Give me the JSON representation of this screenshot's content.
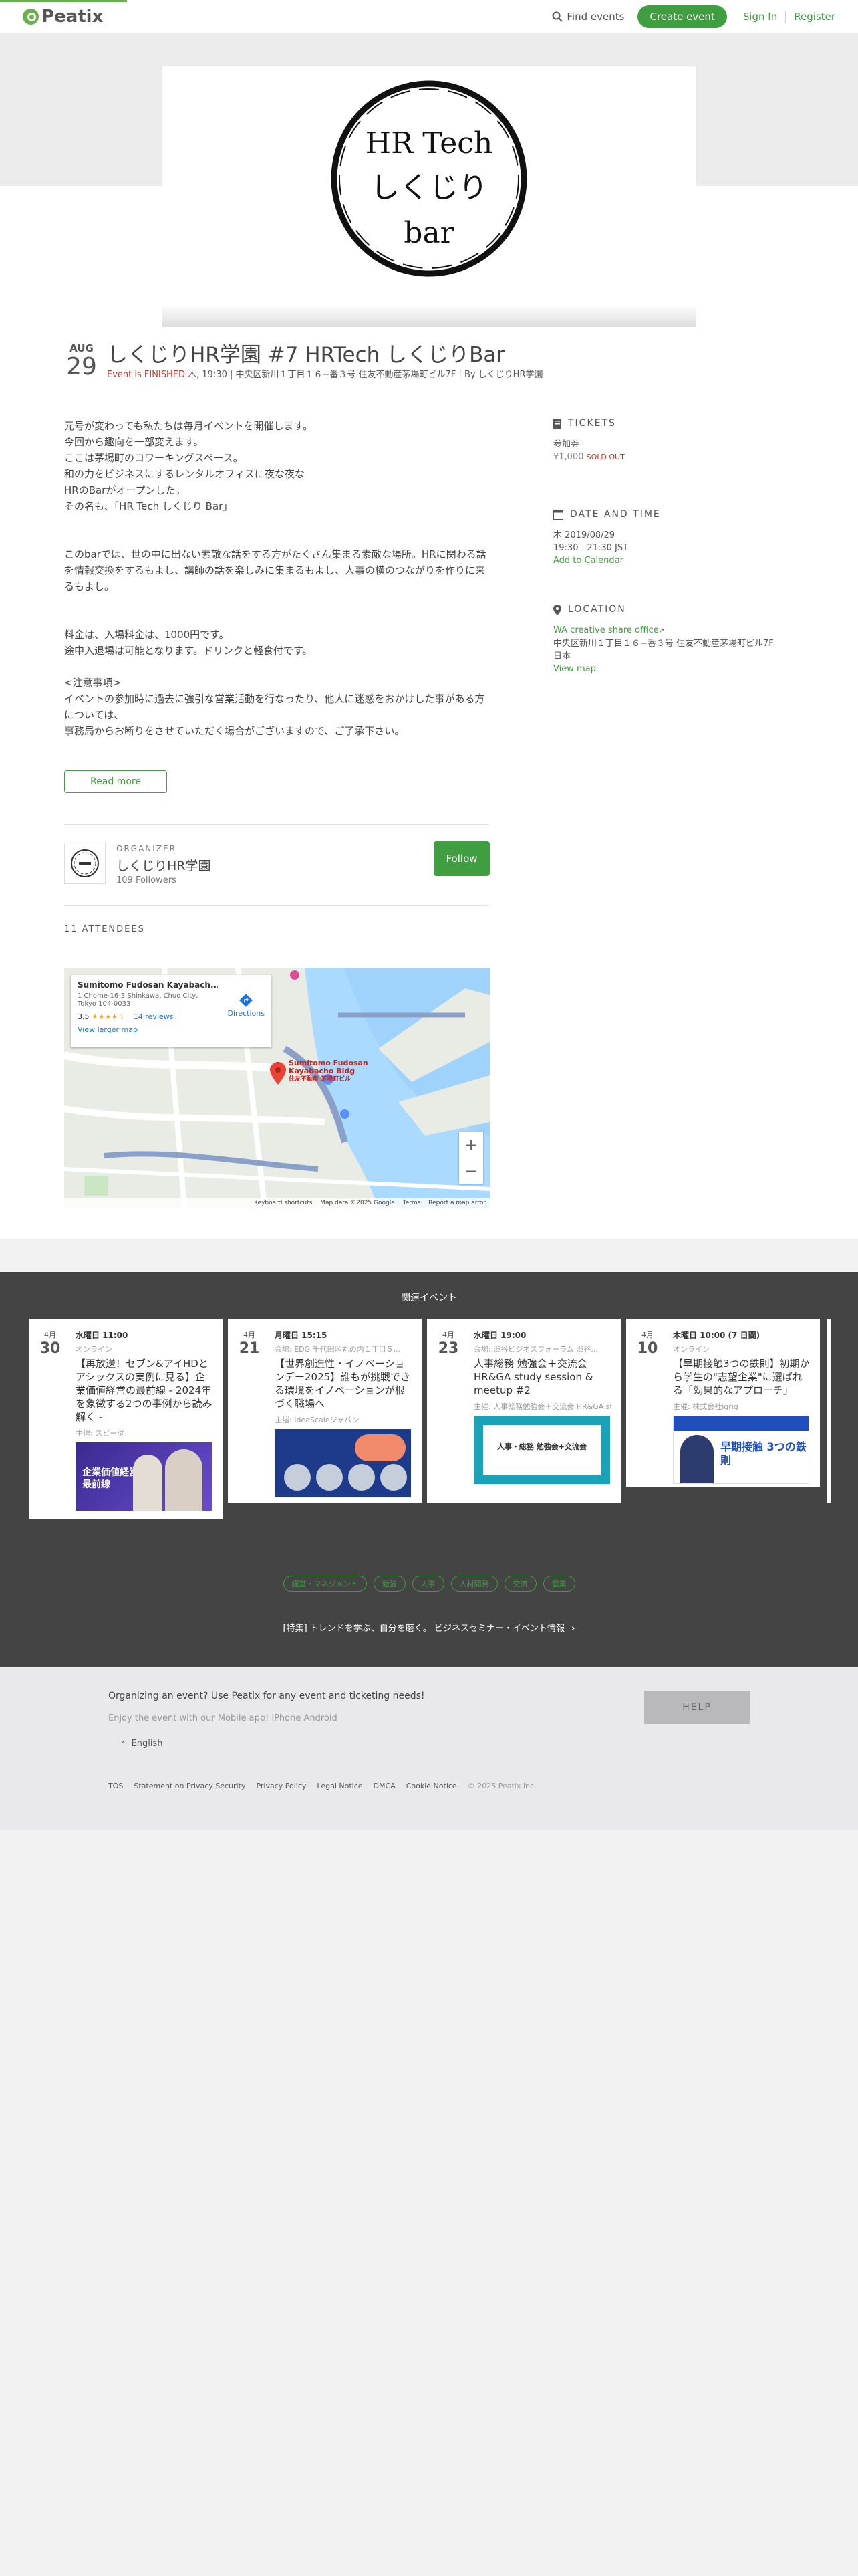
{
  "header": {
    "logo_text": "Peatix",
    "find_events": "Find events",
    "create_event": "Create event",
    "sign_in": "Sign In",
    "register": "Register"
  },
  "hero": {
    "logo_lines": [
      "HR Tech",
      "しくじり",
      "bar"
    ]
  },
  "event": {
    "month": "AUG",
    "day": "29",
    "title": "しくじりHR学園 #7 HRTech しくじりBar",
    "finished": "Event is FINISHED",
    "meta": " 木, 19:30 | 中央区新川１丁目１６−番３号 住友不動産茅場町ビル7F | By しくじりHR学園"
  },
  "description": {
    "para1": [
      "元号が変わっても私たちは毎月イベントを開催します。",
      "今回から趣向を一部変えます。",
      "ここは茅場町のコワーキングスペース。",
      "和の力をビジネスにするレンタルオフィスに夜な夜な",
      "HRのBarがオープンした。",
      "その名も、「HR Tech しくじり Bar」"
    ],
    "para2": [
      "このbarでは、世の中に出ない素敵な話をする方がたくさん集まる素敵な場所。HRに関わる話を情報交換をするもよし、講師の話を楽しみに集まるもよし、人事の横のつながりを作りに来るもよし。"
    ],
    "para3": [
      "料金は、入場料金は、1000円です。",
      "途中入退場は可能となります。ドリンクと軽食付です。"
    ],
    "para4": [
      "<注意事項>",
      "イベントの参加時に過去に強引な営業活動を行なったり、他人に迷惑をおかけした事がある方については、",
      "事務局からお断りをさせていただく場合がございますので、ご了承下さい。"
    ],
    "read_more": "Read more"
  },
  "tickets": {
    "heading": "TICKETS",
    "name": "参加券",
    "price": "¥1,000",
    "status": "SOLD OUT"
  },
  "datetime": {
    "heading": "DATE AND TIME",
    "date": "木 2019/08/29",
    "time": "19:30 - 21:30 JST",
    "add_calendar": "Add to Calendar"
  },
  "location": {
    "heading": "LOCATION",
    "venue": "WA creative share office",
    "address": "中央区新川１丁目１６−番３号 住友不動産茅場町ビル7F",
    "country": "日本",
    "view_map": "View map"
  },
  "organizer": {
    "label": "ORGANIZER",
    "name": "しくじりHR学園",
    "followers": "109 Followers",
    "follow": "Follow"
  },
  "attendees": "11 ATTENDEES",
  "map": {
    "place_name": "Sumitomo Fudosan Kayabach...",
    "address": "1 Chome-16-3 Shinkawa, Chuo City, Tokyo 104-0033",
    "rating": "3.5",
    "stars": "★★★★☆",
    "reviews": "14 reviews",
    "larger_map": "View larger map",
    "directions": "Directions",
    "pin_label_1": "Sumitomo Fudosan",
    "pin_label_2": "Kayabacho Bldg",
    "pin_label_3": "住友不動産 茅場町ビル",
    "foot": [
      "Keyboard shortcuts",
      "Map data ©2025 Google",
      "Terms",
      "Report a map error"
    ],
    "zoom_in": "+",
    "zoom_out": "−"
  },
  "related": {
    "title": "関連イベント",
    "cards": [
      {
        "m": "4月",
        "d": "30",
        "time": "水曜日 11:00",
        "place": "オンライン",
        "title": "【再放送！セブン&アイHDとアシックスの実例に見る】企業価値経営の最前線 - 2024年を象徴する2つの事例から読み解く -",
        "host": "主催: スピーダ",
        "thumb": "企業価値経営の最前線"
      },
      {
        "m": "4月",
        "d": "21",
        "time": "月曜日 15:15",
        "place": "会場: EDG 千代田区丸の内１丁目５...",
        "title": "【世界創造性・イノベーションデー2025】誰もが挑戦できる環境をイノベーションが根づく職場へ",
        "host": "主催: IdeaScaleジャパン",
        "thumb": ""
      },
      {
        "m": "4月",
        "d": "23",
        "time": "水曜日 19:00",
        "place": "会場: 渋谷ビジネスフォーラム 渋谷...",
        "title": "人事総務 勉強会＋交流会 HR&GA study session & meetup #2",
        "host": "主催: 人事総務勉強会＋交流会 HR&GA study session & meetup",
        "thumb": "人事・総務 勉強会+交流会"
      },
      {
        "m": "4月",
        "d": "10",
        "time": "木曜日 10:00 (7 日間)",
        "place": "オンライン",
        "title": "【早期接触3つの鉄則】初期から学生の\"志望企業\"に選ばれる「効果的なアプローチ」",
        "host": "主催: 株式会社igrig",
        "thumb": "早期接触 3つの鉄則"
      }
    ],
    "tags": [
      "経営・マネジメント",
      "勉強",
      "人事",
      "人材開発",
      "交流",
      "営業"
    ],
    "feature": "[特集] トレンドを学ぶ、自分を磨く。 ビジネスセミナー・イベント情報"
  },
  "footer": {
    "organizing": "Organizing an event? Use Peatix for any event and ticketing needs!",
    "app": "Enjoy the event with our Mobile app!",
    "iphone": "iPhone",
    "android": "Android",
    "language": "English",
    "help": "HELP",
    "links": [
      "TOS",
      "Statement on Privacy Security",
      "Privacy Policy",
      "Legal Notice",
      "DMCA",
      "Cookie Notice"
    ],
    "copyright": "© 2025 Peatix Inc."
  },
  "colors": {
    "brand": "#3f9e3f",
    "finished": "#c0392b"
  }
}
